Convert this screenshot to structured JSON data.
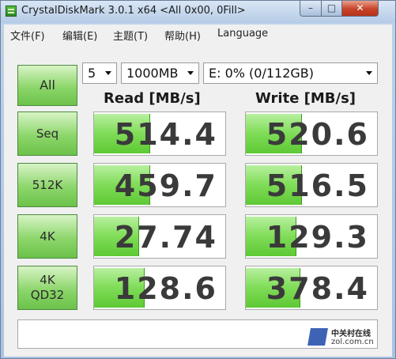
{
  "window": {
    "title": "CrystalDiskMark 3.0.1 x64 <All 0x00, 0Fill>",
    "minimize_glyph": "–",
    "maximize_glyph": "□",
    "close_glyph": "✕"
  },
  "menu": [
    "文件(F)",
    "编辑(E)",
    "主题(T)",
    "帮助(H)",
    "Language"
  ],
  "controls": {
    "all_label": "All",
    "runs": "5",
    "size": "1000MB",
    "drive": "E: 0% (0/112GB)"
  },
  "columns": {
    "read": "Read [MB/s]",
    "write": "Write [MB/s]"
  },
  "rows": [
    {
      "label_line1": "Seq",
      "label_line2": "",
      "read": "514.4",
      "write": "520.6",
      "read_fill": 0.42,
      "write_fill": 0.42
    },
    {
      "label_line1": "512K",
      "label_line2": "",
      "read": "459.7",
      "write": "516.5",
      "read_fill": 0.42,
      "write_fill": 0.42
    },
    {
      "label_line1": "4K",
      "label_line2": "",
      "read": "27.74",
      "write": "129.3",
      "read_fill": 0.34,
      "write_fill": 0.38
    },
    {
      "label_line1": "4K",
      "label_line2": "QD32",
      "read": "128.6",
      "write": "378.4",
      "read_fill": 0.38,
      "write_fill": 0.41
    }
  ],
  "comment": "",
  "watermark": {
    "cn": "中关村在线",
    "en": "zol.com.cn"
  },
  "colors": {
    "bar_green": "#7fdc57",
    "button_green": "#8cd66b",
    "value_text": "#3a3a3a"
  }
}
